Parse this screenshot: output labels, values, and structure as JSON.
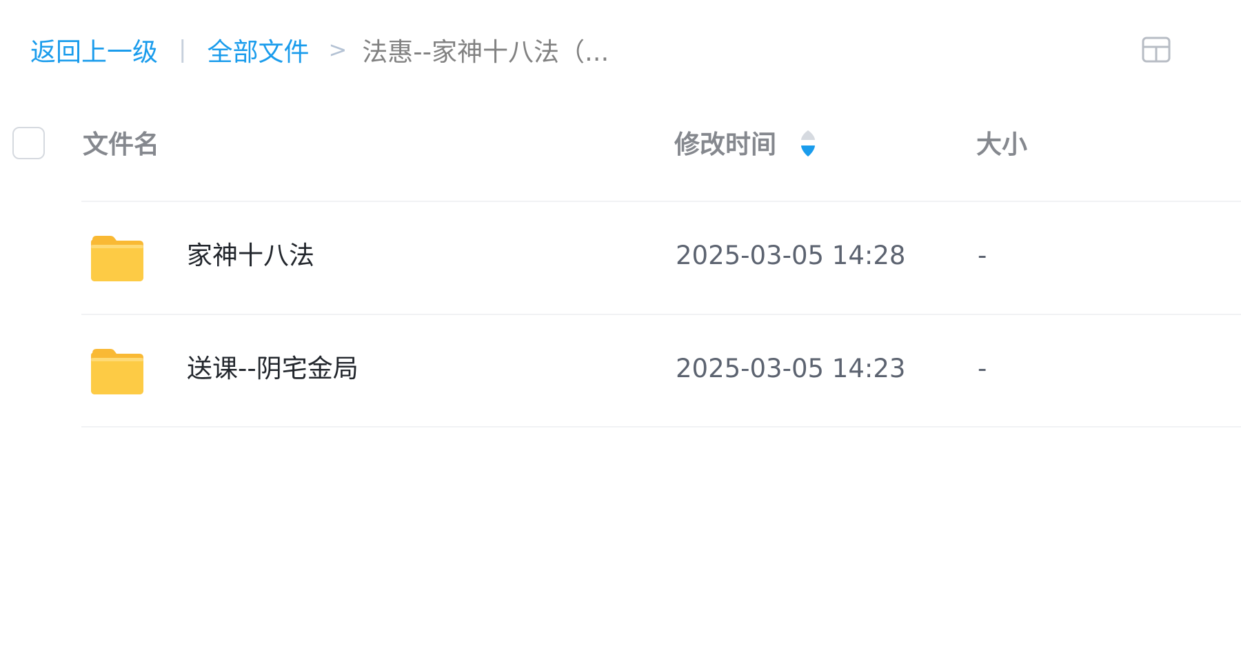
{
  "breadcrumb": {
    "back_label": "返回上一级",
    "separator": "|",
    "root_label": "全部文件",
    "arrow": ">",
    "current_label": "法惠--家神十八法（..."
  },
  "view_toggle": {
    "icon": "grid-view-icon"
  },
  "columns": {
    "name": "文件名",
    "modified": "修改时间",
    "size": "大小"
  },
  "sort": {
    "icon": "sort-icon",
    "active_direction": "descending",
    "active_color": "#1a9cec"
  },
  "files": [
    {
      "name": "家神十八法",
      "modified": "2025-03-05 14:28",
      "size": "-",
      "type": "folder"
    },
    {
      "name": "送课--阴宅金局",
      "modified": "2025-03-05 14:23",
      "size": "-",
      "type": "folder"
    }
  ],
  "colors": {
    "link": "#1a9cec",
    "folder": "#fcc33a",
    "header_text": "#85888e",
    "body_text": "#22262c"
  }
}
